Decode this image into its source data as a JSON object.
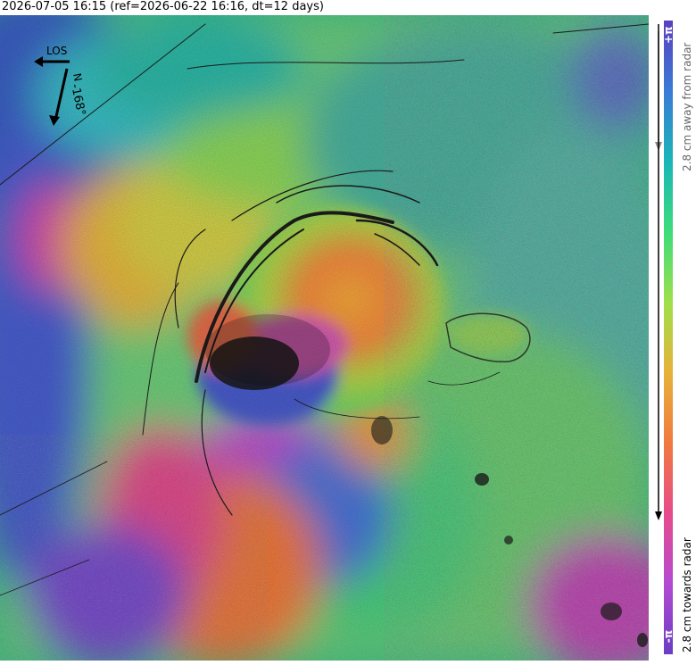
{
  "title": "2026-07-05 16:15 (ref=2026-06-22 16:16, dt=12 days)",
  "compass": {
    "los_label": "LOS",
    "north_label": "N",
    "heading_label": "-168°"
  },
  "colorbar": {
    "top_label": "+π",
    "bottom_label": "-π",
    "upper_text": "2.8 cm away from radar",
    "lower_text": "2.8 cm towards radar",
    "colors": [
      "#5b3fbf",
      "#3a7bd5",
      "#19b6b8",
      "#3ddc7a",
      "#9ee04a",
      "#e7b23a",
      "#f07a3e",
      "#e84b8a",
      "#b44ad2",
      "#6a3dc4"
    ]
  }
}
